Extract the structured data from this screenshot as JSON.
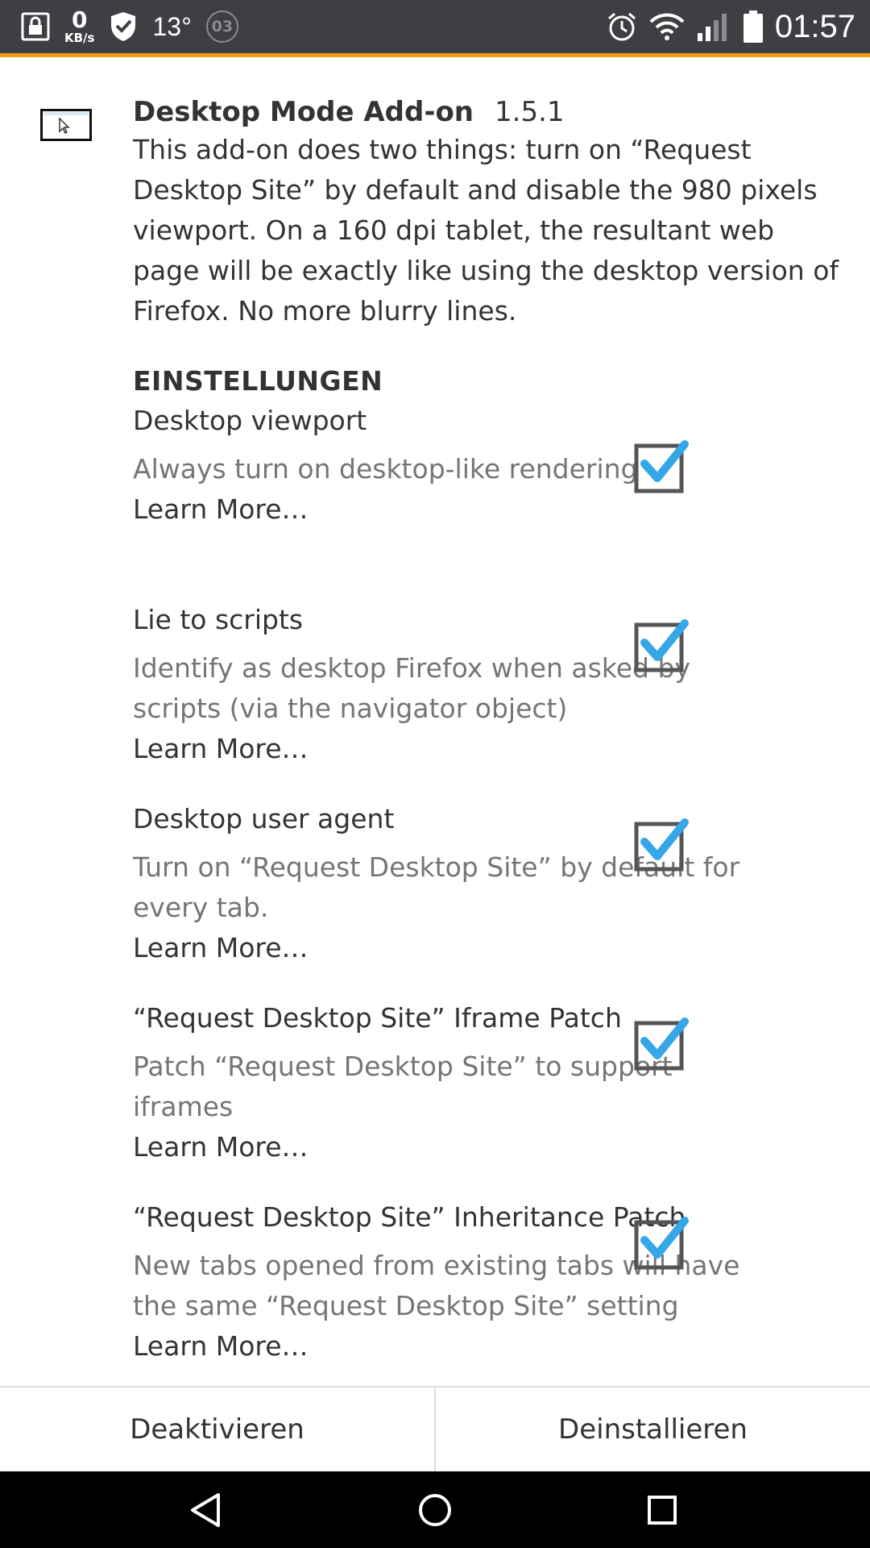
{
  "status_bar": {
    "net_speed_value": "0",
    "net_speed_unit": "KB/s",
    "temperature": "13°",
    "badge": "03",
    "time": "01:57"
  },
  "addon": {
    "name": "Desktop Mode Add-on",
    "version": "1.5.1",
    "description": "This add-on does two things: turn on “Request Desktop Site” by default and disable the 980 pixels viewport. On a 160 dpi tablet, the resultant web page will be exactly like using the desktop version of Firefox. No more blurry lines."
  },
  "settings_heading": "EINSTELLUNGEN",
  "settings": [
    {
      "title": "Desktop viewport",
      "description": "Always turn on desktop-like rendering",
      "learn_more": "Learn More…",
      "checked": true
    },
    {
      "title": "Lie to scripts",
      "description": "Identify as desktop Firefox when asked by scripts (via the navigator object)",
      "learn_more": "Learn More…",
      "checked": true
    },
    {
      "title": "Desktop user agent",
      "description": "Turn on “Request Desktop Site” by default for every tab.",
      "learn_more": "Learn More…",
      "checked": true
    },
    {
      "title": "“Request Desktop Site” Iframe Patch",
      "description": "Patch “Request Desktop Site” to support iframes",
      "learn_more": "Learn More…",
      "checked": true
    },
    {
      "title": "“Request Desktop Site” Inheritance Patch",
      "description": "New tabs opened from existing tabs will have the same “Request Desktop Site” setting",
      "learn_more": "Learn More…",
      "checked": true
    }
  ],
  "buttons": {
    "disable": "Deaktivieren",
    "uninstall": "Deinstallieren"
  },
  "colors": {
    "status_bar": "#3d3f43",
    "accent": "#f59a14",
    "checkmark": "#35a6e8"
  },
  "icons": {
    "status_left": [
      "lock-icon",
      "shield-icon"
    ],
    "status_right": [
      "alarm-icon",
      "wifi-icon",
      "signal-icon",
      "battery-icon"
    ],
    "nav": [
      "back-icon",
      "home-icon",
      "recents-icon"
    ]
  }
}
